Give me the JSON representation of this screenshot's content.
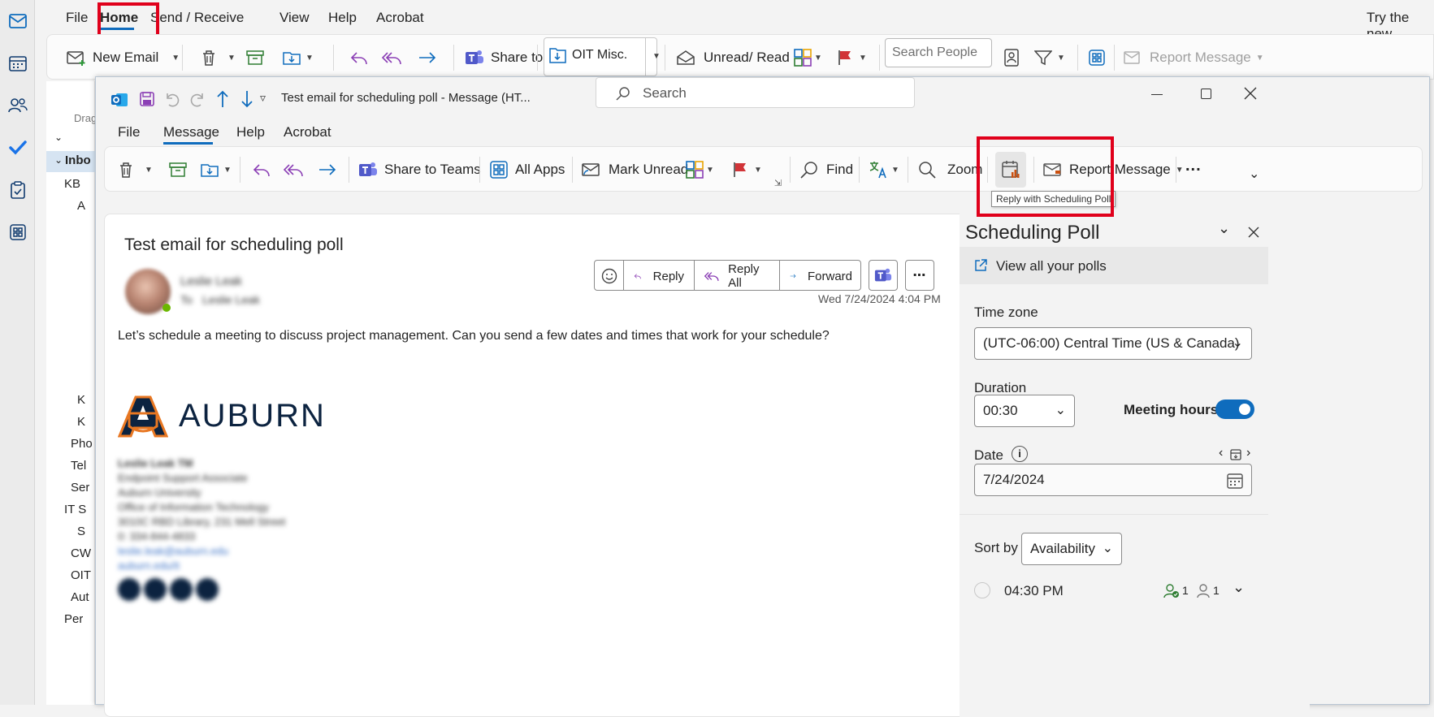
{
  "main_menu": {
    "tabs": [
      "File",
      "Home",
      "Send / Receive",
      "View",
      "Help",
      "Acrobat"
    ],
    "active_tab": "Home",
    "try_new": "Try the new"
  },
  "main_ribbon": {
    "new_email": "New Email",
    "share_to_teams": "Share to Teams",
    "quick_step": "OIT Misc.",
    "unread_read": "Unread/ Read",
    "search_people_placeholder": "Search People",
    "report_message": "Report Message"
  },
  "folder_pane": {
    "drag_text": "Drag",
    "inbox": "Inbo",
    "items": [
      "KB",
      "A",
      "K",
      "K",
      "Pho",
      "Tel",
      "Ser",
      "IT S",
      "S",
      "CW",
      "OIT",
      "Aut",
      "Per"
    ]
  },
  "message_window": {
    "title": "Test email for scheduling poll  -  Message (HT...",
    "search_placeholder": "Search",
    "tabs": [
      "File",
      "Message",
      "Help",
      "Acrobat"
    ],
    "active_tab": "Message"
  },
  "message_ribbon": {
    "share_to_teams": "Share to Teams",
    "all_apps": "All Apps",
    "mark_unread": "Mark Unread",
    "find": "Find",
    "zoom": "Zoom",
    "report_message": "Report Message",
    "more": "...",
    "tooltip": "Reply with Scheduling Poll"
  },
  "email": {
    "subject": "Test email for scheduling poll",
    "sender_name": "Leslie Leak",
    "to_label": "To",
    "to_name": "Leslie Leak",
    "reply": "Reply",
    "reply_all": "Reply All",
    "forward": "Forward",
    "date": "Wed 7/24/2024 4:04 PM",
    "body": "Let’s schedule a meeting to discuss project management. Can you send a few dates and times that work for your schedule?",
    "logo_text": "AUBURN",
    "signature_lines": [
      "Leslie Leak TM",
      "Endpoint Support Associate",
      "Auburn University",
      "Office of Information Technology",
      "3010C RBD Library, 231 Mell Street",
      "0: 334-844-4833",
      "leslie.leak@auburn.edu",
      "auburn.edu/it"
    ]
  },
  "poll": {
    "title": "Scheduling Poll",
    "view_all": "View all your polls",
    "time_zone_label": "Time zone",
    "time_zone_value": "(UTC-06:00) Central Time (US & Canada)",
    "duration_label": "Duration",
    "duration_value": "00:30",
    "meeting_hours_label": "Meeting hours",
    "meeting_hours_on": true,
    "date_label": "Date",
    "date_value": "7/24/2024",
    "sort_by_label": "Sort by",
    "sort_by_value": "Availability",
    "slot_time": "04:30 PM",
    "slot_available_count": "1",
    "slot_attendee_count": "1"
  },
  "colors": {
    "highlight": "#e0001b",
    "accent": "#0f6cbd",
    "auburn_navy": "#0c2340",
    "auburn_orange": "#e87722"
  }
}
